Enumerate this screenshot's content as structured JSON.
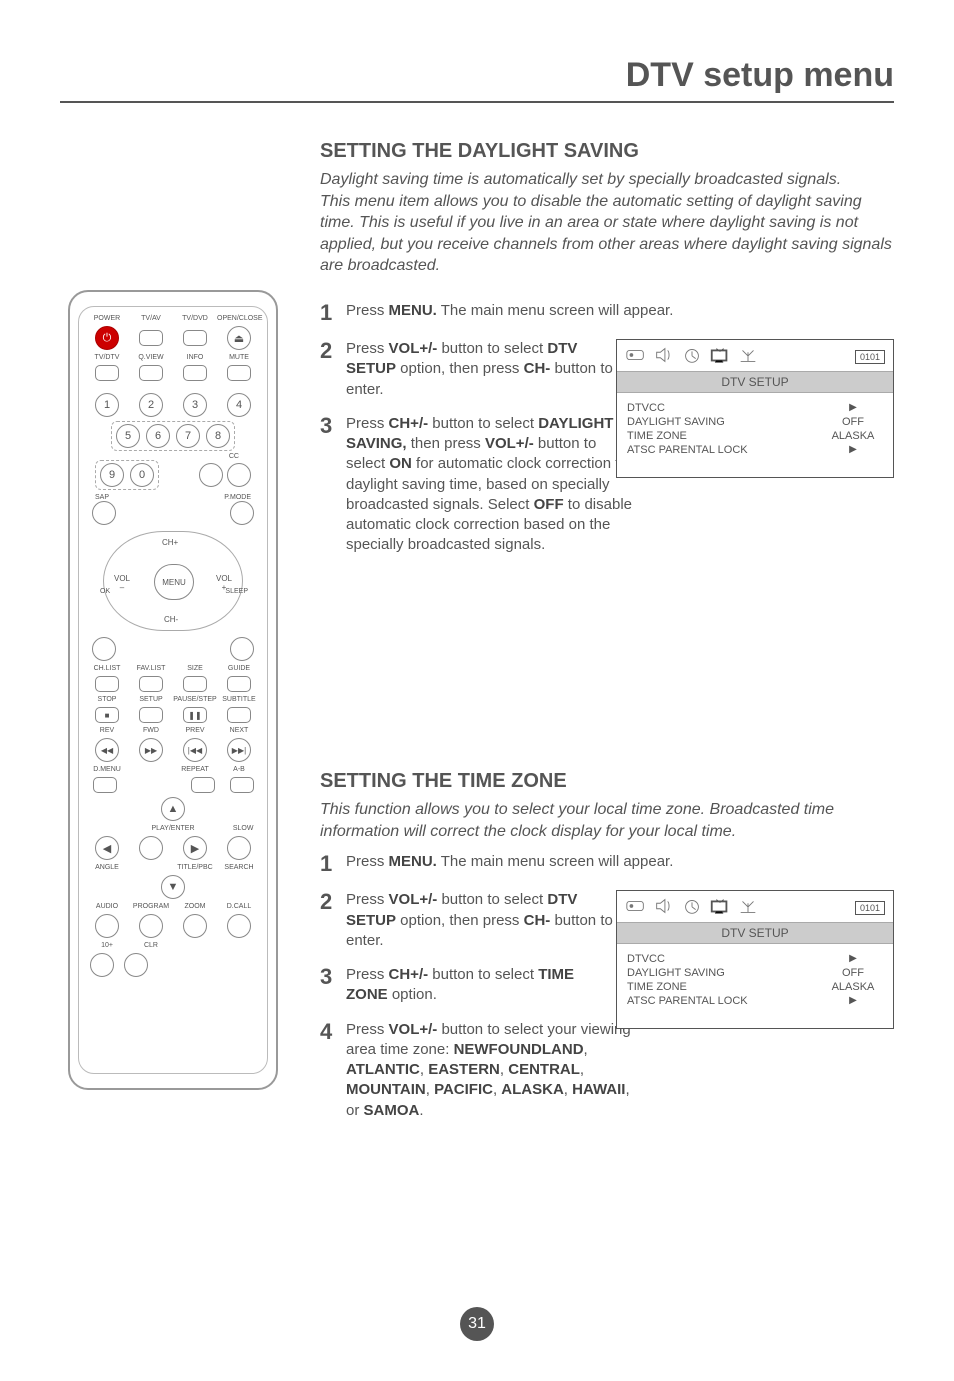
{
  "header": {
    "title": "DTV setup menu"
  },
  "remote": {
    "r1": [
      "POWER",
      "TV/AV",
      "TV/DVD",
      "OPEN/CLOSE"
    ],
    "power_glyph": "⏻",
    "eject_glyph": "⏏",
    "r2": [
      "TV/DTV",
      "Q.VIEW",
      "INFO",
      "MUTE"
    ],
    "num": [
      "1",
      "2",
      "3",
      "4",
      "5",
      "6",
      "7",
      "8",
      "9",
      "0"
    ],
    "cc": "CC",
    "sap": "SAP",
    "pmode": "P.MODE",
    "ring": {
      "center": "MENU",
      "top": "CH+",
      "bottom": "CH-",
      "left": "VOL\n–",
      "right": "VOL\n+",
      "ok": "OK",
      "sleep": "SLEEP"
    },
    "r3": [
      "CH.LIST",
      "FAV.LIST",
      "SIZE",
      "GUIDE"
    ],
    "r4": [
      "STOP",
      "SETUP",
      "PAUSE/STEP",
      "SUBTITLE"
    ],
    "stop_glyph": "■",
    "pause_glyph": "❚❚",
    "r5": [
      "REV",
      "FWD",
      "PREV",
      "NEXT"
    ],
    "r5g": [
      "◀◀",
      "▶▶",
      "|◀◀",
      "▶▶|"
    ],
    "r6": [
      "D.MENU",
      "",
      "REPEAT",
      "A-B"
    ],
    "r7": [
      "",
      "PLAY/ENTER",
      "",
      "SLOW"
    ],
    "r7arrows": {
      "up": "▲",
      "left": "◀",
      "right": "▶",
      "down": "▼"
    },
    "r8": [
      "ANGLE",
      "",
      "TITLE/PBC",
      "SEARCH"
    ],
    "r9": [
      "AUDIO",
      "PROGRAM",
      "ZOOM",
      "D.CALL"
    ],
    "r10": [
      "10+",
      "CLR",
      "",
      ""
    ]
  },
  "daylight": {
    "title": "SETTING THE DAYLIGHT SAVING",
    "intro": "Daylight saving time is automatically set by specially broadcasted signals.\nThis menu item allows you to disable the automatic setting of daylight saving time. This is useful if you live in an area or state where daylight saving is not applied, but you receive channels from other areas where daylight saving signals are broadcasted.",
    "step1_num": "1",
    "step1_a": "Press ",
    "step1_b": "MENU.",
    "step1_c": " The main menu screen will appear.",
    "step2_num": "2",
    "step2_a": "Press ",
    "step2_b": "VOL+/-",
    "step2_c": " button to select ",
    "step2_d": "DTV SETUP",
    "step2_e": " option, then press ",
    "step2_f": "CH-",
    "step2_g": " button to enter.",
    "step3_num": "3",
    "step3_a": "Press ",
    "step3_b": "CH+/-",
    "step3_c": " button to select ",
    "step3_d": "DAYLIGHT SAVING,",
    "step3_e": " then press ",
    "step3_f": "VOL+/-",
    "step3_g": " button to select ",
    "step3_h": "ON",
    "step3_i": " for automatic clock correction for daylight saving time, based on specially broadcasted signals. Select ",
    "step3_j": "OFF",
    "step3_k": " to disable automatic clock correction based on the specially broadcasted signals."
  },
  "osd1": {
    "badge": "0101",
    "title": "DTV SETUP",
    "rows": [
      {
        "k": "DTVCC",
        "v": "▶"
      },
      {
        "k": "DAYLIGHT SAVING",
        "v": "OFF"
      },
      {
        "k": "TIME ZONE",
        "v": "ALASKA"
      },
      {
        "k": "ATSC PARENTAL LOCK",
        "v": "▶"
      }
    ]
  },
  "timezone": {
    "title": "SETTING THE TIME ZONE",
    "intro": "This function allows you to select your local time zone. Broadcasted time information will correct the clock display for your local time.",
    "step1_num": "1",
    "step1_a": "Press ",
    "step1_b": "MENU.",
    "step1_c": " The main menu screen will appear.",
    "step2_num": "2",
    "step2_a": "Press ",
    "step2_b": "VOL+/-",
    "step2_c": " button to select ",
    "step2_d": "DTV SETUP",
    "step2_e": " option, then press ",
    "step2_f": "CH-",
    "step2_g": " button to enter.",
    "step3_num": "3",
    "step3_a": "Press ",
    "step3_b": "CH+/-",
    "step3_c": " button to select ",
    "step3_d": "TIME ZONE",
    "step3_e": " option.",
    "step4_num": "4",
    "step4_a": "Press ",
    "step4_b": "VOL+/-",
    "step4_c": " button to select your viewing area time zone: ",
    "step4_d": "NEWFOUNDLAND",
    "step4_e": ", ",
    "step4_f": "ATLANTIC",
    "step4_g": ", ",
    "step4_h": "EASTERN",
    "step4_i": ", ",
    "step4_j": "CENTRAL",
    "step4_k": ", ",
    "step4_l": "MOUNTAIN",
    "step4_m": ", ",
    "step4_n": "PACIFIC",
    "step4_o": ", ",
    "step4_p": "ALASKA",
    "step4_q": ", ",
    "step4_r": "HAWAII",
    "step4_s": ", or ",
    "step4_t": "SAMOA",
    "step4_u": "."
  },
  "osd2": {
    "badge": "0101",
    "title": "DTV SETUP",
    "rows": [
      {
        "k": "DTVCC",
        "v": "▶"
      },
      {
        "k": "DAYLIGHT SAVING",
        "v": "OFF"
      },
      {
        "k": "TIME ZONE",
        "v": "ALASKA"
      },
      {
        "k": "ATSC PARENTAL LOCK",
        "v": "▶"
      }
    ]
  },
  "page_number": "31"
}
